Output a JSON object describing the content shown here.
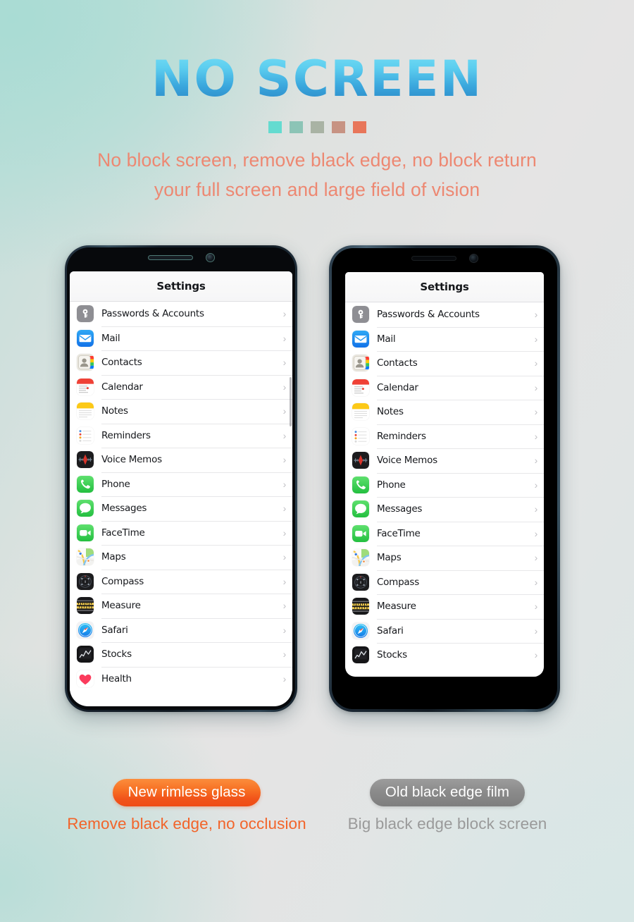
{
  "header": {
    "headline": "NO SCREEN",
    "subtitle_line1": "No block screen, remove black edge, no block return",
    "subtitle_line2": "your full screen and large field of vision",
    "headline_gradient_from": "#72dcf4",
    "headline_gradient_to": "#2a85c4",
    "subtitle_color": "#ed8872",
    "squares": [
      {
        "name": "square-1",
        "color": "#64dbd0"
      },
      {
        "name": "square-2",
        "color": "#8cc4b6"
      },
      {
        "name": "square-3",
        "color": "#a9b3a4"
      },
      {
        "name": "square-4",
        "color": "#c79383"
      },
      {
        "name": "square-5",
        "color": "#e8765a"
      }
    ]
  },
  "background": {
    "top_left": "#a9dcd4",
    "middle": "#e4e3e3",
    "bottom_right": "#d8e7e6"
  },
  "phones": [
    {
      "variant": "new",
      "name": "phone-new-rimless-glass",
      "nav_title": "Settings",
      "bezel_style": "thin rimless bezel",
      "has_visible_speaker": true,
      "scrollbar_visible": true
    },
    {
      "variant": "old",
      "name": "phone-old-black-edge-film",
      "nav_title": "Settings",
      "bezel_style": "thick black edge film",
      "has_visible_speaker": false,
      "scrollbar_visible": false
    }
  ],
  "settings_list": {
    "chevron": "›",
    "items_new": [
      {
        "label": "Passwords & Accounts",
        "icon": "passwords-icon"
      },
      {
        "label": "Mail",
        "icon": "mail-icon"
      },
      {
        "label": "Contacts",
        "icon": "contacts-icon"
      },
      {
        "label": "Calendar",
        "icon": "calendar-icon"
      },
      {
        "label": "Notes",
        "icon": "notes-icon"
      },
      {
        "label": "Reminders",
        "icon": "reminders-icon"
      },
      {
        "label": "Voice Memos",
        "icon": "voice-memos-icon"
      },
      {
        "label": "Phone",
        "icon": "phone-icon"
      },
      {
        "label": "Messages",
        "icon": "messages-icon"
      },
      {
        "label": "FaceTime",
        "icon": "facetime-icon"
      },
      {
        "label": "Maps",
        "icon": "maps-icon"
      },
      {
        "label": "Compass",
        "icon": "compass-icon"
      },
      {
        "label": "Measure",
        "icon": "measure-icon"
      },
      {
        "label": "Safari",
        "icon": "safari-icon"
      },
      {
        "label": "Stocks",
        "icon": "stocks-icon"
      },
      {
        "label": "Health",
        "icon": "health-icon"
      }
    ],
    "items_old": [
      {
        "label": "Passwords & Accounts",
        "icon": "passwords-icon"
      },
      {
        "label": "Mail",
        "icon": "mail-icon"
      },
      {
        "label": "Contacts",
        "icon": "contacts-icon"
      },
      {
        "label": "Calendar",
        "icon": "calendar-icon"
      },
      {
        "label": "Notes",
        "icon": "notes-icon"
      },
      {
        "label": "Reminders",
        "icon": "reminders-icon"
      },
      {
        "label": "Voice Memos",
        "icon": "voice-memos-icon"
      },
      {
        "label": "Phone",
        "icon": "phone-icon"
      },
      {
        "label": "Messages",
        "icon": "messages-icon"
      },
      {
        "label": "FaceTime",
        "icon": "facetime-icon"
      },
      {
        "label": "Maps",
        "icon": "maps-icon"
      },
      {
        "label": "Compass",
        "icon": "compass-icon"
      },
      {
        "label": "Measure",
        "icon": "measure-icon"
      },
      {
        "label": "Safari",
        "icon": "safari-icon"
      },
      {
        "label": "Stocks",
        "icon": "stocks-icon"
      }
    ]
  },
  "captions": {
    "left": {
      "pill": "New rimless glass",
      "sub": "Remove black edge, no occlusion",
      "pill_color": "#f1541a",
      "sub_color": "#f2642a"
    },
    "right": {
      "pill": "Old black edge film",
      "sub": "Big black edge block screen",
      "pill_color": "#8b8b8b",
      "sub_color": "#9a9a9a"
    }
  }
}
